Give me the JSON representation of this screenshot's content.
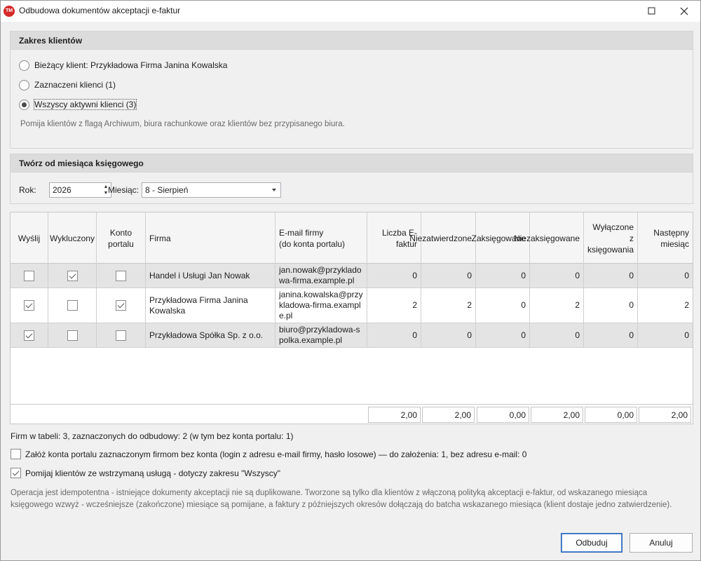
{
  "window": {
    "logo_text": "TM",
    "title": "Odbudowa dokumentów akceptacji e-faktur"
  },
  "client_scope": {
    "heading": "Zakres klientów",
    "options": [
      {
        "label": "Bieżący klient: Przykładowa Firma Janina Kowalska",
        "selected": false
      },
      {
        "label": "Zaznaczeni klienci (1)",
        "selected": false
      },
      {
        "label": "Wszyscy aktywni klienci (3)",
        "selected": true
      }
    ],
    "hint": "Pomija klientów z flagą Archiwum, biura rachunkowe oraz klientów bez przypisanego biura."
  },
  "period": {
    "heading": "Twórz od miesiąca księgowego",
    "year_label": "Rok:",
    "year_value": "2026",
    "month_label": "Miesiąc:",
    "month_value": "8 - Sierpień"
  },
  "table": {
    "columns": [
      "Wyślij",
      "Wykluczony",
      "Konto portalu",
      "Firma",
      "E-mail firmy\n(do konta portalu)",
      "Liczba E-faktur",
      "Niezatwierdzone",
      "Zaksięgowane",
      "Niezaksięgowane",
      "Wyłączone z księgowania",
      "Następny miesiąc"
    ],
    "rows": [
      {
        "send": false,
        "excluded": true,
        "portal": false,
        "company": "Handel i Usługi Jan Nowak",
        "email": "jan.nowak@przykladowa-firma.example.pl",
        "count": "0",
        "unapproved": "0",
        "booked": "0",
        "unbooked": "0",
        "excluded_booking": "0",
        "next_month": "0"
      },
      {
        "send": true,
        "excluded": false,
        "portal": true,
        "company": "Przykładowa Firma Janina Kowalska",
        "email": "janina.kowalska@przykladowa-firma.example.pl",
        "count": "2",
        "unapproved": "2",
        "booked": "0",
        "unbooked": "2",
        "excluded_booking": "0",
        "next_month": "2"
      },
      {
        "send": true,
        "excluded": false,
        "portal": false,
        "company": "Przykładowa Spółka Sp. z o.o.",
        "email": "biuro@przykladowa-spolka.example.pl",
        "count": "0",
        "unapproved": "0",
        "booked": "0",
        "unbooked": "0",
        "excluded_booking": "0",
        "next_month": "0"
      }
    ],
    "totals": [
      "2,00",
      "2,00",
      "0,00",
      "2,00",
      "0,00",
      "2,00"
    ]
  },
  "summary": "Firm w tabeli: 3, zaznaczonych do odbudowy: 2 (w tym bez konta portalu: 1)",
  "options": {
    "create_accounts": {
      "label": "Załóż konta portalu zaznaczonym firmom bez konta (login z adresu e-mail firmy, hasło losowe) — do założenia: 1, bez adresu e-mail: 0",
      "checked": false
    },
    "skip_suspended": {
      "label": "Pomijaj klientów ze wstrzymaną usługą - dotyczy zakresu \"Wszyscy\"",
      "checked": true
    }
  },
  "note": "Operacja jest idempotentna - istniejące dokumenty akceptacji nie są duplikowane. Tworzone są tylko dla klientów z włączoną polityką akceptacji e-faktur, od wskazanego miesiąca księgowego wzwyż - wcześniejsze (zakończone) miesiące są pomijane, a faktury z późniejszych okresów dołączają do batcha wskazanego miesiąca (klient dostaje jedno zatwierdzenie).",
  "buttons": {
    "rebuild": "Odbuduj",
    "cancel": "Anuluj"
  }
}
